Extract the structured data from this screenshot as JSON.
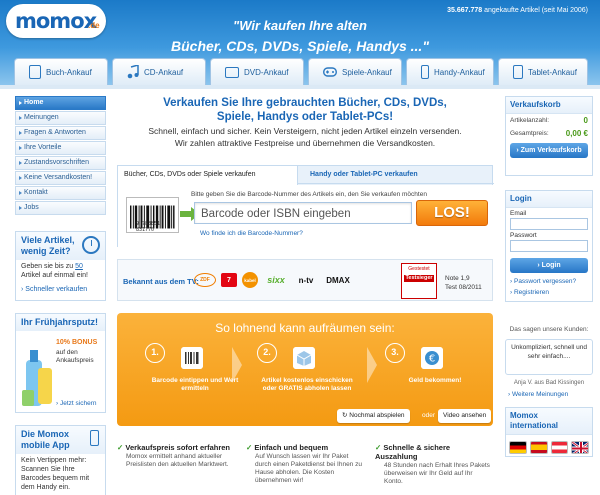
{
  "header": {
    "logo_text": "momox",
    "logo_suffix": ".de",
    "counter_value": "35.667.778",
    "counter_text": "angekaufte Artikel (seit Mai 2006)",
    "slogan_line1": "\"Wir kaufen Ihre alten",
    "slogan_line2": "Bücher, CDs, DVDs, Spiele, Handys ...\""
  },
  "nav": {
    "tabs": [
      {
        "label": "Buch-Ankauf",
        "icon": "book-icon"
      },
      {
        "label": "CD-Ankauf",
        "icon": "music-note-icon"
      },
      {
        "label": "DVD-Ankauf",
        "icon": "film-icon"
      },
      {
        "label": "Spiele-Ankauf",
        "icon": "gamepad-icon"
      },
      {
        "label": "Handy-Ankauf",
        "icon": "phone-icon"
      },
      {
        "label": "Tablet-Ankauf",
        "icon": "tablet-icon"
      }
    ]
  },
  "sidebar": {
    "items": [
      "Home",
      "Meinungen",
      "Fragen & Antworten",
      "Ihre Vorteile",
      "Zustandsvorschriften",
      "Keine Versandkosten!",
      "Kontakt",
      "Jobs"
    ],
    "box1": {
      "title": "Viele Artikel, wenig Zeit?",
      "text_pre": "Geben sie bis zu",
      "text_link": "50",
      "text_post": "Artikel auf einmal ein!",
      "link": "Schneller verkaufen"
    },
    "box2": {
      "title": "Ihr Frühjahrsputz!",
      "bonus": "10% BONUS",
      "bonus_text": "auf den Ankaufspreis",
      "link": "Jetzt sichern"
    },
    "box3": {
      "title": "Die Momox mobile App",
      "text": "Kein Vertippen mehr: Scannen Sie Ihre Barcodes bequem mit dem Handy ein."
    }
  },
  "main": {
    "headline_1": "Verkaufen Sie Ihre gebrauchten Bücher, CDs, DVDs,",
    "headline_2": "Spiele, Handys oder Tablet-PCs!",
    "sub_1": "Schnell, einfach und sicher. Kein Versteigern, nicht jeden Artikel einzeln versenden.",
    "sub_2": "Wir zahlen attraktive Festpreise und übernehmen die Versandkosten.",
    "search": {
      "tab_active": "Bücher, CDs, DVDs oder Spiele verkaufen",
      "tab_other": "Handy oder Tablet-PC verkaufen",
      "hint": "Bitte geben Sie die Barcode-Nummer des Artikels ein, den Sie verkaufen möchten",
      "placeholder": "Barcode oder ISBN eingeben",
      "button": "LOS!",
      "link": "Wo finde ich die Barcode-Nummer?",
      "barcode_digits": "9 783851 831770"
    },
    "tv": {
      "label": "Bekannt aus dem TV:",
      "logos": [
        "ZDF",
        "7",
        "kabel",
        "sixx",
        "n-tv",
        "DMAX"
      ],
      "badge_top": "Gestestet",
      "badge_mid": "Testsieger",
      "note_1": "Note 1,9",
      "note_2": "Test 08/2011"
    },
    "steps": {
      "title": "So lohnend kann aufräumen sein:",
      "items": [
        {
          "num": "1.",
          "text": "Barcode eintippen und Wert ermitteln",
          "icon": "barcode-icon"
        },
        {
          "num": "2.",
          "text": "Artikel kostenlos einschicken oder GRATIS abholen lassen",
          "icon": "package-icon"
        },
        {
          "num": "3.",
          "text": "Geld bekommen!",
          "icon": "euro-icon"
        }
      ],
      "video_button": "Nochmal abspielen",
      "video_or": "oder",
      "video_button2": "Video ansehen"
    },
    "features": [
      {
        "title": "Verkaufspreis sofort erfahren",
        "text": "Momox ermittelt anhand aktueller Preislisten den aktuellen Marktwert."
      },
      {
        "title": "Einfach und bequem",
        "text": "Auf Wunsch lassen wir Ihr Paket durch einen Paketdienst bei Ihnen zu Hause abholen. Die Kosten übernehmen wir!"
      },
      {
        "title": "Schnelle & sichere Auszahlung",
        "text": "48 Stunden nach Erhalt Ihres Pakets überweisen wir Ihr Geld auf Ihr Konto."
      }
    ]
  },
  "cart": {
    "title": "Verkaufskorb",
    "count_label": "Artikelanzahl:",
    "count_value": "0",
    "price_label": "Gesamtpreis:",
    "price_value": "0,00 €",
    "button": "Zum Verkaufskorb"
  },
  "login": {
    "title": "Login",
    "email_label": "Email",
    "password_label": "Passwort",
    "button": "Login",
    "link_forgot": "Passwort vergessen?",
    "link_register": "Registrieren"
  },
  "testimonial": {
    "intro": "Das sagen unsere Kunden:",
    "quote": "Unkompliziert, schnell und sehr einfach....",
    "author": "Anja V. aus Bad Kissingen",
    "link": "Weitere Meinungen"
  },
  "international": {
    "title": "Momox international",
    "flags": [
      "germany-flag",
      "spain-flag",
      "austria-flag",
      "uk-flag"
    ]
  }
}
